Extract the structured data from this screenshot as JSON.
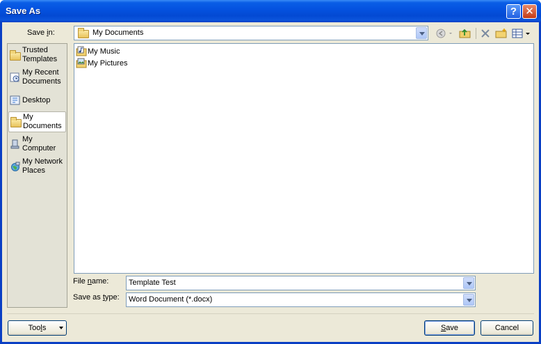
{
  "window": {
    "title": "Save As"
  },
  "titlebar": {
    "help_label": "?",
    "close_label": "✕"
  },
  "save_in": {
    "label_pre": "Save ",
    "label_key": "i",
    "label_post": "n:",
    "value": "My Documents"
  },
  "toolbar": {
    "icons": [
      "back-icon",
      "up-one-level-icon",
      "delete-icon",
      "new-folder-icon",
      "views-icon"
    ]
  },
  "places": [
    {
      "label": "Trusted Templates",
      "icon": "folder-icon"
    },
    {
      "label": "My Recent Documents",
      "icon": "recent-documents-icon"
    },
    {
      "label": "Desktop",
      "icon": "desktop-icon"
    },
    {
      "label": "My Documents",
      "icon": "my-documents-icon",
      "selected": true
    },
    {
      "label": "My Computer",
      "icon": "my-computer-icon"
    },
    {
      "label": "My Network Places",
      "icon": "network-places-icon"
    }
  ],
  "files": [
    {
      "name": "My Music",
      "icon": "music-folder-icon"
    },
    {
      "name": "My Pictures",
      "icon": "pictures-folder-icon"
    }
  ],
  "file_name": {
    "label_pre": "File ",
    "label_key": "n",
    "label_post": "ame:",
    "value": "Template Test"
  },
  "save_as_type": {
    "label_pre": "Save as ",
    "label_key": "t",
    "label_post": "ype:",
    "value": "Word Document (*.docx)"
  },
  "buttons": {
    "tools_pre": "Too",
    "tools_key": "l",
    "tools_post": "s",
    "save_key": "S",
    "save_post": "ave",
    "cancel": "Cancel"
  }
}
